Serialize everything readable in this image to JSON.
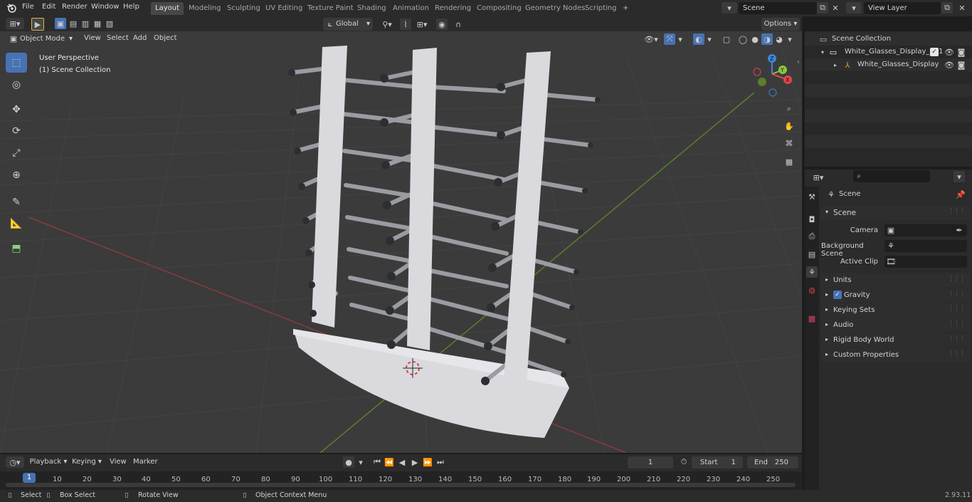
{
  "topbar": {
    "menus": [
      "File",
      "Edit",
      "Render",
      "Window",
      "Help"
    ],
    "workspaces": [
      "Layout",
      "Modeling",
      "Sculpting",
      "UV Editing",
      "Texture Paint",
      "Shading",
      "Animation",
      "Rendering",
      "Compositing",
      "Geometry Nodes",
      "Scripting"
    ],
    "active_workspace": "Layout",
    "add_tab": "+",
    "scene_name": "Scene",
    "view_layer": "View Layer"
  },
  "tool_header": {
    "transform_orientation": "Global",
    "options_label": "Options"
  },
  "viewport_header": {
    "mode": "Object Mode",
    "menus": [
      "View",
      "Select",
      "Add",
      "Object"
    ]
  },
  "viewport": {
    "perspective_label": "User Perspective",
    "collection_label": "(1) Scene Collection",
    "gizmo_axes": [
      "Z",
      "Y",
      "X"
    ]
  },
  "outliner": {
    "root": "Scene Collection",
    "items": [
      {
        "label": "White_Glasses_Display_001",
        "level": 1
      },
      {
        "label": "White_Glasses_Display",
        "level": 2
      }
    ]
  },
  "properties": {
    "context_title": "Scene",
    "section": "Scene",
    "fields": [
      {
        "label": "Camera",
        "value": ""
      },
      {
        "label": "Background Scene",
        "value": ""
      },
      {
        "label": "Active Clip",
        "value": ""
      }
    ],
    "subpanels": [
      {
        "label": "Units",
        "checkbox": false
      },
      {
        "label": "Gravity",
        "checkbox": true
      },
      {
        "label": "Keying Sets",
        "checkbox": false
      },
      {
        "label": "Audio",
        "checkbox": false
      },
      {
        "label": "Rigid Body World",
        "checkbox": false
      },
      {
        "label": "Custom Properties",
        "checkbox": false
      }
    ]
  },
  "timeline": {
    "menus": [
      "Playback",
      "Keying",
      "View",
      "Marker"
    ],
    "current_frame": "1",
    "start_label": "Start",
    "start_value": "1",
    "end_label": "End",
    "end_value": "250",
    "ticks": [
      "1",
      "10",
      "20",
      "30",
      "40",
      "50",
      "60",
      "70",
      "80",
      "90",
      "100",
      "110",
      "120",
      "130",
      "140",
      "150",
      "160",
      "170",
      "180",
      "190",
      "200",
      "210",
      "220",
      "230",
      "240",
      "250"
    ]
  },
  "statusbar": {
    "items": [
      "Select",
      "Box Select",
      "Rotate View",
      "Object Context Menu"
    ],
    "version": "2.93.11"
  },
  "colors": {
    "accent": "#4772b3",
    "axis_x": "#e0444d",
    "axis_y": "#8bc53f",
    "axis_z": "#3d87d8",
    "model": "#d9d9de"
  }
}
